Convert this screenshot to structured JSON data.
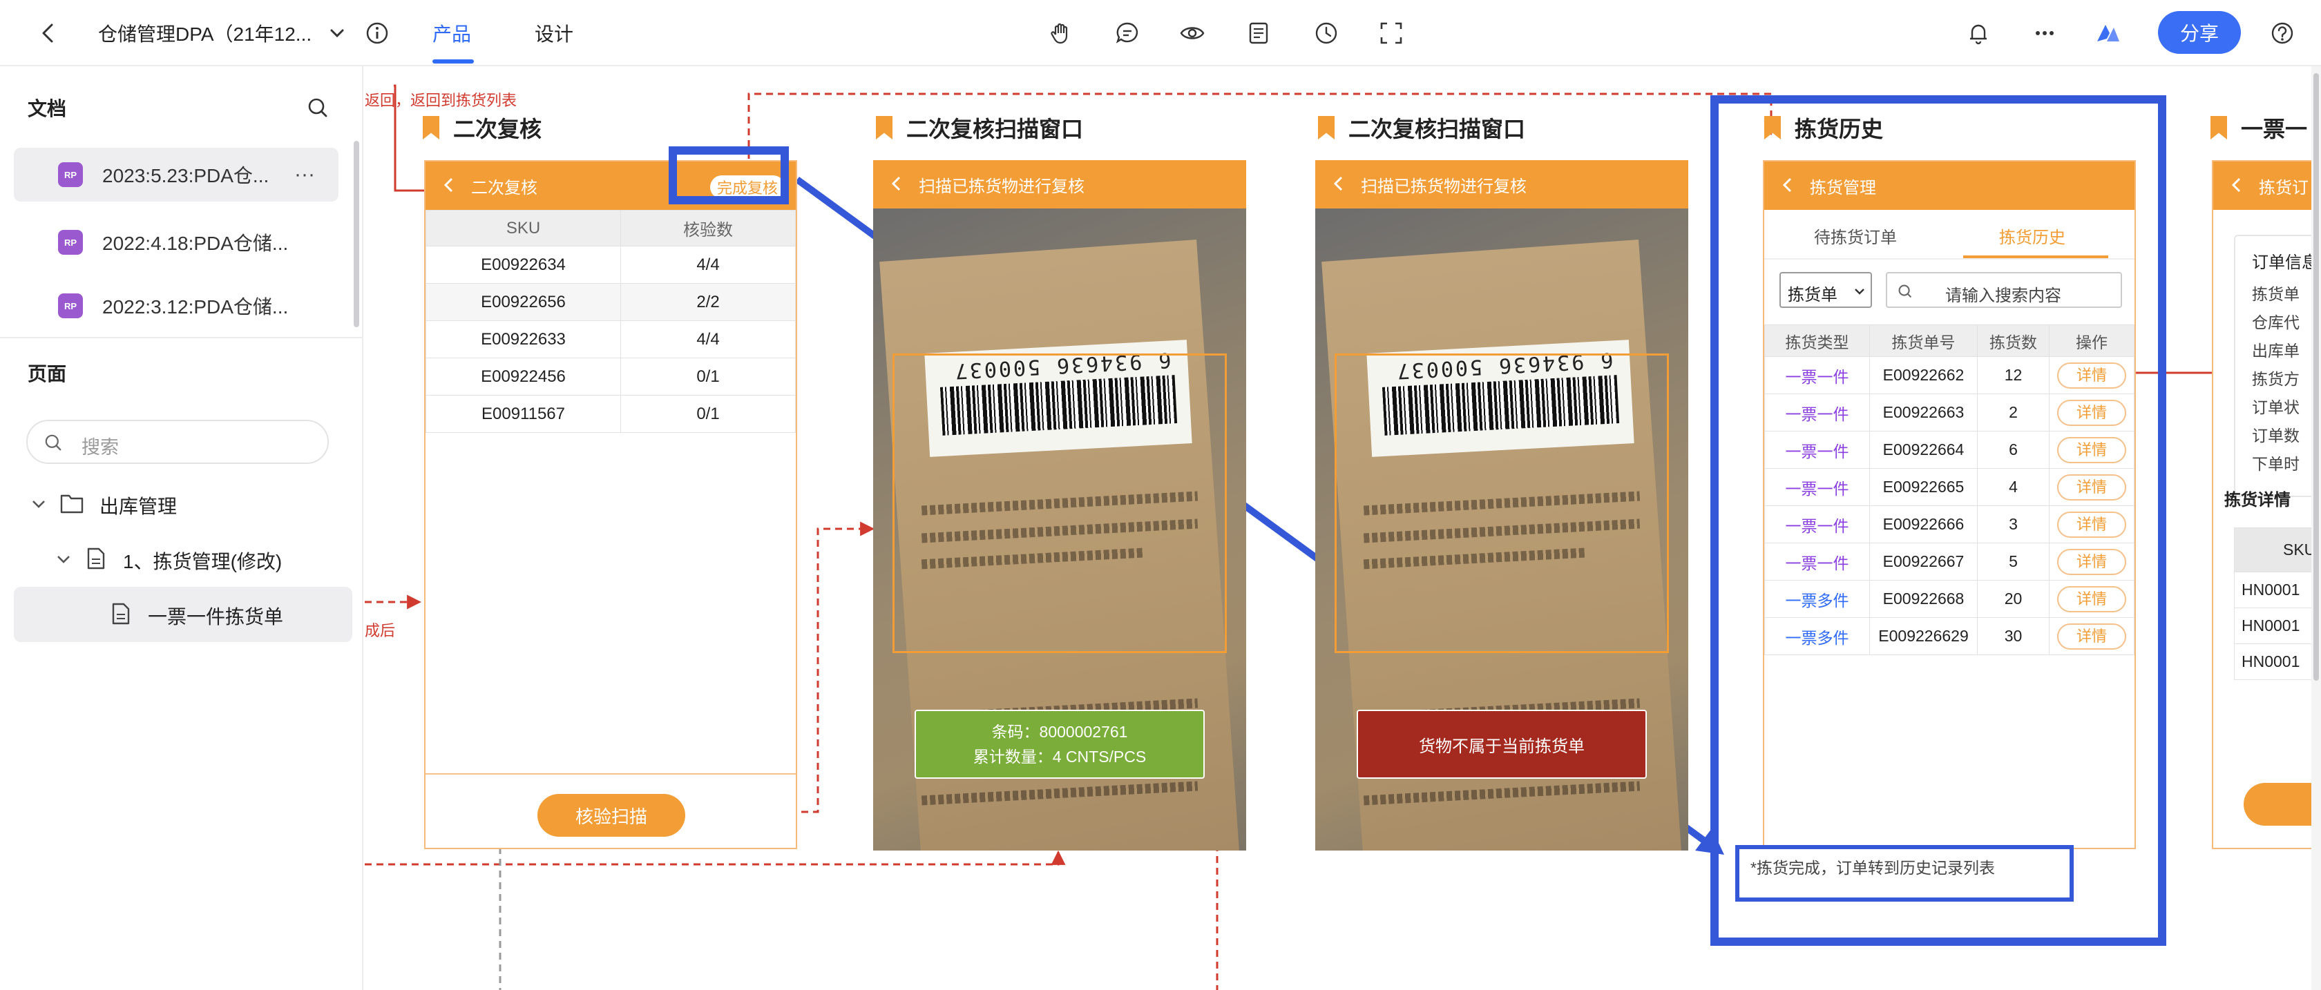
{
  "topbar": {
    "doc_title": "仓储管理DPA（21年12...",
    "tabs": [
      "产品",
      "设计"
    ],
    "share_label": "分享"
  },
  "sidebar": {
    "docs_heading": "文档",
    "docs": [
      {
        "badge": "RP",
        "label": "2023:5.23:PDA仓..."
      },
      {
        "badge": "RP",
        "label": "2022:4.18:PDA仓储..."
      },
      {
        "badge": "RP",
        "label": "2022:3.12:PDA仓储..."
      }
    ],
    "more": "···",
    "pages_heading": "页面",
    "search_placeholder": "搜索",
    "tree": [
      {
        "label": "出库管理"
      },
      {
        "label": "1、拣货管理(修改)"
      },
      {
        "label": "一票一件拣货单"
      }
    ]
  },
  "canvas": {
    "annotations": {
      "back_note": "返回，返回到拣货列表",
      "done_note": "成后",
      "history_note": "*拣货完成，订单转到历史记录列表"
    },
    "screen1": {
      "section_title": "二次复核",
      "header": "二次复核",
      "complete_btn": "完成复核",
      "columns": [
        "SKU",
        "核验数"
      ],
      "rows": [
        [
          "E00922634",
          "4/4"
        ],
        [
          "E00922656",
          "2/2"
        ],
        [
          "E00922633",
          "4/4"
        ],
        [
          "E00922456",
          "0/1"
        ],
        [
          "E00911567",
          "0/1"
        ]
      ],
      "scan_btn": "核验扫描"
    },
    "screen2": {
      "section_title": "二次复核扫描窗口",
      "header": "扫描已拣货物进行复核",
      "barcode": "6 934636 500037",
      "result_line1": "条码：8000002761",
      "result_line2": "累计数量：4 CNTS/PCS"
    },
    "screen3": {
      "section_title": "二次复核扫描窗口",
      "header": "扫描已拣货物进行复核",
      "barcode": "6 934636 500037",
      "error_msg": "货物不属于当前拣货单"
    },
    "screen4": {
      "section_title": "拣货历史",
      "header": "拣货管理",
      "tabs": [
        "待拣货订单",
        "拣货历史"
      ],
      "filter": "拣货单",
      "search_placeholder": "请输入搜索内容",
      "columns": [
        "拣货类型",
        "拣货单号",
        "拣货数",
        "操作"
      ],
      "rows": [
        {
          "type": "一票一件",
          "no": "E00922662",
          "qty": "12",
          "action": "详情",
          "kind": "single"
        },
        {
          "type": "一票一件",
          "no": "E00922663",
          "qty": "2",
          "action": "详情",
          "kind": "single"
        },
        {
          "type": "一票一件",
          "no": "E00922664",
          "qty": "6",
          "action": "详情",
          "kind": "single"
        },
        {
          "type": "一票一件",
          "no": "E00922665",
          "qty": "4",
          "action": "详情",
          "kind": "single"
        },
        {
          "type": "一票一件",
          "no": "E00922666",
          "qty": "3",
          "action": "详情",
          "kind": "single"
        },
        {
          "type": "一票一件",
          "no": "E00922667",
          "qty": "5",
          "action": "详情",
          "kind": "single"
        },
        {
          "type": "一票多件",
          "no": "E00922668",
          "qty": "20",
          "action": "详情",
          "kind": "multi"
        },
        {
          "type": "一票多件",
          "no": "E009226629",
          "qty": "30",
          "action": "详情",
          "kind": "multi"
        }
      ]
    },
    "screen5": {
      "section_title": "一票一",
      "header": "拣货订",
      "info_title": "订单信息",
      "info_lines": [
        "拣货单",
        "仓库代",
        "出库单",
        "拣货方",
        "订单状",
        "订单数",
        "下单时"
      ],
      "detail_title": "拣货详情",
      "col": "SKU",
      "rows": [
        "HN0001",
        "HN0001",
        "HN0001"
      ]
    }
  },
  "colors": {
    "accent_orange": "#f29d35",
    "primary_blue": "#3a6ef5",
    "highlight_blue": "#3558d8",
    "success_green": "#7aad3a",
    "error_red": "#a42a1f",
    "annotation_red": "#d13b2f"
  }
}
